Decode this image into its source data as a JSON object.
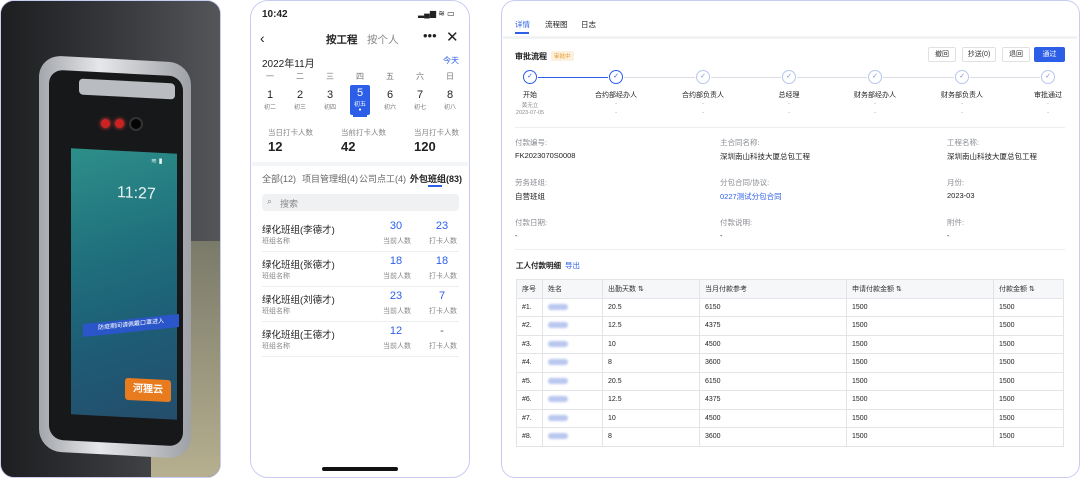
{
  "photo": {
    "clock": "11:27",
    "ticker": "防疫期间请佩戴口罩进入",
    "brand": "河狸云"
  },
  "phone": {
    "status_time": "10:42",
    "tabs_top": [
      "按工程",
      "按个人"
    ],
    "month": "2022年11月",
    "today": "今天",
    "days": [
      {
        "week": "一",
        "day": "1",
        "lunar": "初二"
      },
      {
        "week": "二",
        "day": "2",
        "lunar": "初三"
      },
      {
        "week": "三",
        "day": "3",
        "lunar": "初四"
      },
      {
        "week": "四",
        "day": "5",
        "lunar": "初五",
        "selected": true
      },
      {
        "week": "五",
        "day": "6",
        "lunar": "初六"
      },
      {
        "week": "六",
        "day": "7",
        "lunar": "初七"
      },
      {
        "week": "日",
        "day": "8",
        "lunar": "初八"
      }
    ],
    "stats": [
      {
        "label": "当日打卡人数",
        "value": "12"
      },
      {
        "label": "当前打卡人数",
        "value": "42"
      },
      {
        "label": "当月打卡人数",
        "value": "120"
      }
    ],
    "group_tabs": [
      "全部(12)",
      "项目管理组(4)",
      "公司点工(4)",
      "外包班组(83)"
    ],
    "search_placeholder": "搜索",
    "groups": [
      {
        "name": "绿化班组(李德才)",
        "sub": "班组名称",
        "a": "30",
        "a_label": "当前人数",
        "b": "23",
        "b_label": "打卡人数"
      },
      {
        "name": "绿化班组(张德才)",
        "sub": "班组名称",
        "a": "18",
        "a_label": "当前人数",
        "b": "18",
        "b_label": "打卡人数"
      },
      {
        "name": "绿化班组(刘德才)",
        "sub": "班组名称",
        "a": "23",
        "a_label": "当前人数",
        "b": "7",
        "b_label": "打卡人数"
      },
      {
        "name": "绿化班组(王德才)",
        "sub": "班组名称",
        "a": "12",
        "a_label": "当前人数",
        "b": "-",
        "b_label": "打卡人数"
      }
    ]
  },
  "desk": {
    "tabs": [
      "详情",
      "流程图",
      "日志"
    ],
    "flow_title": "审批流程",
    "flow_badge": "审批中",
    "buttons": [
      "撤回",
      "抄送(0)",
      "退回",
      "通过"
    ],
    "steps": [
      {
        "name": "开始",
        "who": "黄无立",
        "date": "2023-07-05"
      },
      {
        "name": "合约部经办人",
        "who": "-",
        "date": "-"
      },
      {
        "name": "合约部负责人",
        "who": "-",
        "date": "-"
      },
      {
        "name": "总经理",
        "who": "-",
        "date": "-"
      },
      {
        "name": "财务部经办人",
        "who": "-",
        "date": "-"
      },
      {
        "name": "财务部负责人",
        "who": "-",
        "date": "-"
      },
      {
        "name": "审批通过",
        "who": "-",
        "date": "-"
      }
    ],
    "fields": [
      {
        "label": "付款编号:",
        "value": "FK2023070S0008"
      },
      {
        "label": "主合同名称:",
        "value": "深圳南山科技大厦总包工程"
      },
      {
        "label": "工程名称:",
        "value": "深圳南山科技大厦总包工程"
      },
      {
        "label": "劳务班组:",
        "value": "自营班组"
      },
      {
        "label": "分包合同/协议:",
        "value": "0227测试分包合同"
      },
      {
        "label": "月份:",
        "value": "2023-03"
      },
      {
        "label": "付款日期:",
        "value": "-"
      },
      {
        "label": "付款说明:",
        "value": "-"
      },
      {
        "label": "附件:",
        "value": "-"
      }
    ],
    "table_title": "工人付款明细",
    "export": "导出",
    "columns": [
      "序号",
      "姓名",
      "出勤天数 ⇅",
      "当月付款参考",
      "申请付款金额 ⇅",
      "付款金额 ⇅"
    ],
    "rows": [
      [
        "#1.",
        "20.5",
        "6150",
        "1500",
        "1500"
      ],
      [
        "#2.",
        "12.5",
        "4375",
        "1500",
        "1500"
      ],
      [
        "#3.",
        "10",
        "4500",
        "1500",
        "1500"
      ],
      [
        "#4.",
        "8",
        "3600",
        "1500",
        "1500"
      ],
      [
        "#5.",
        "20.5",
        "6150",
        "1500",
        "1500"
      ],
      [
        "#6.",
        "12.5",
        "4375",
        "1500",
        "1500"
      ],
      [
        "#7.",
        "10",
        "4500",
        "1500",
        "1500"
      ],
      [
        "#8.",
        "8",
        "3600",
        "1500",
        "1500"
      ]
    ]
  }
}
